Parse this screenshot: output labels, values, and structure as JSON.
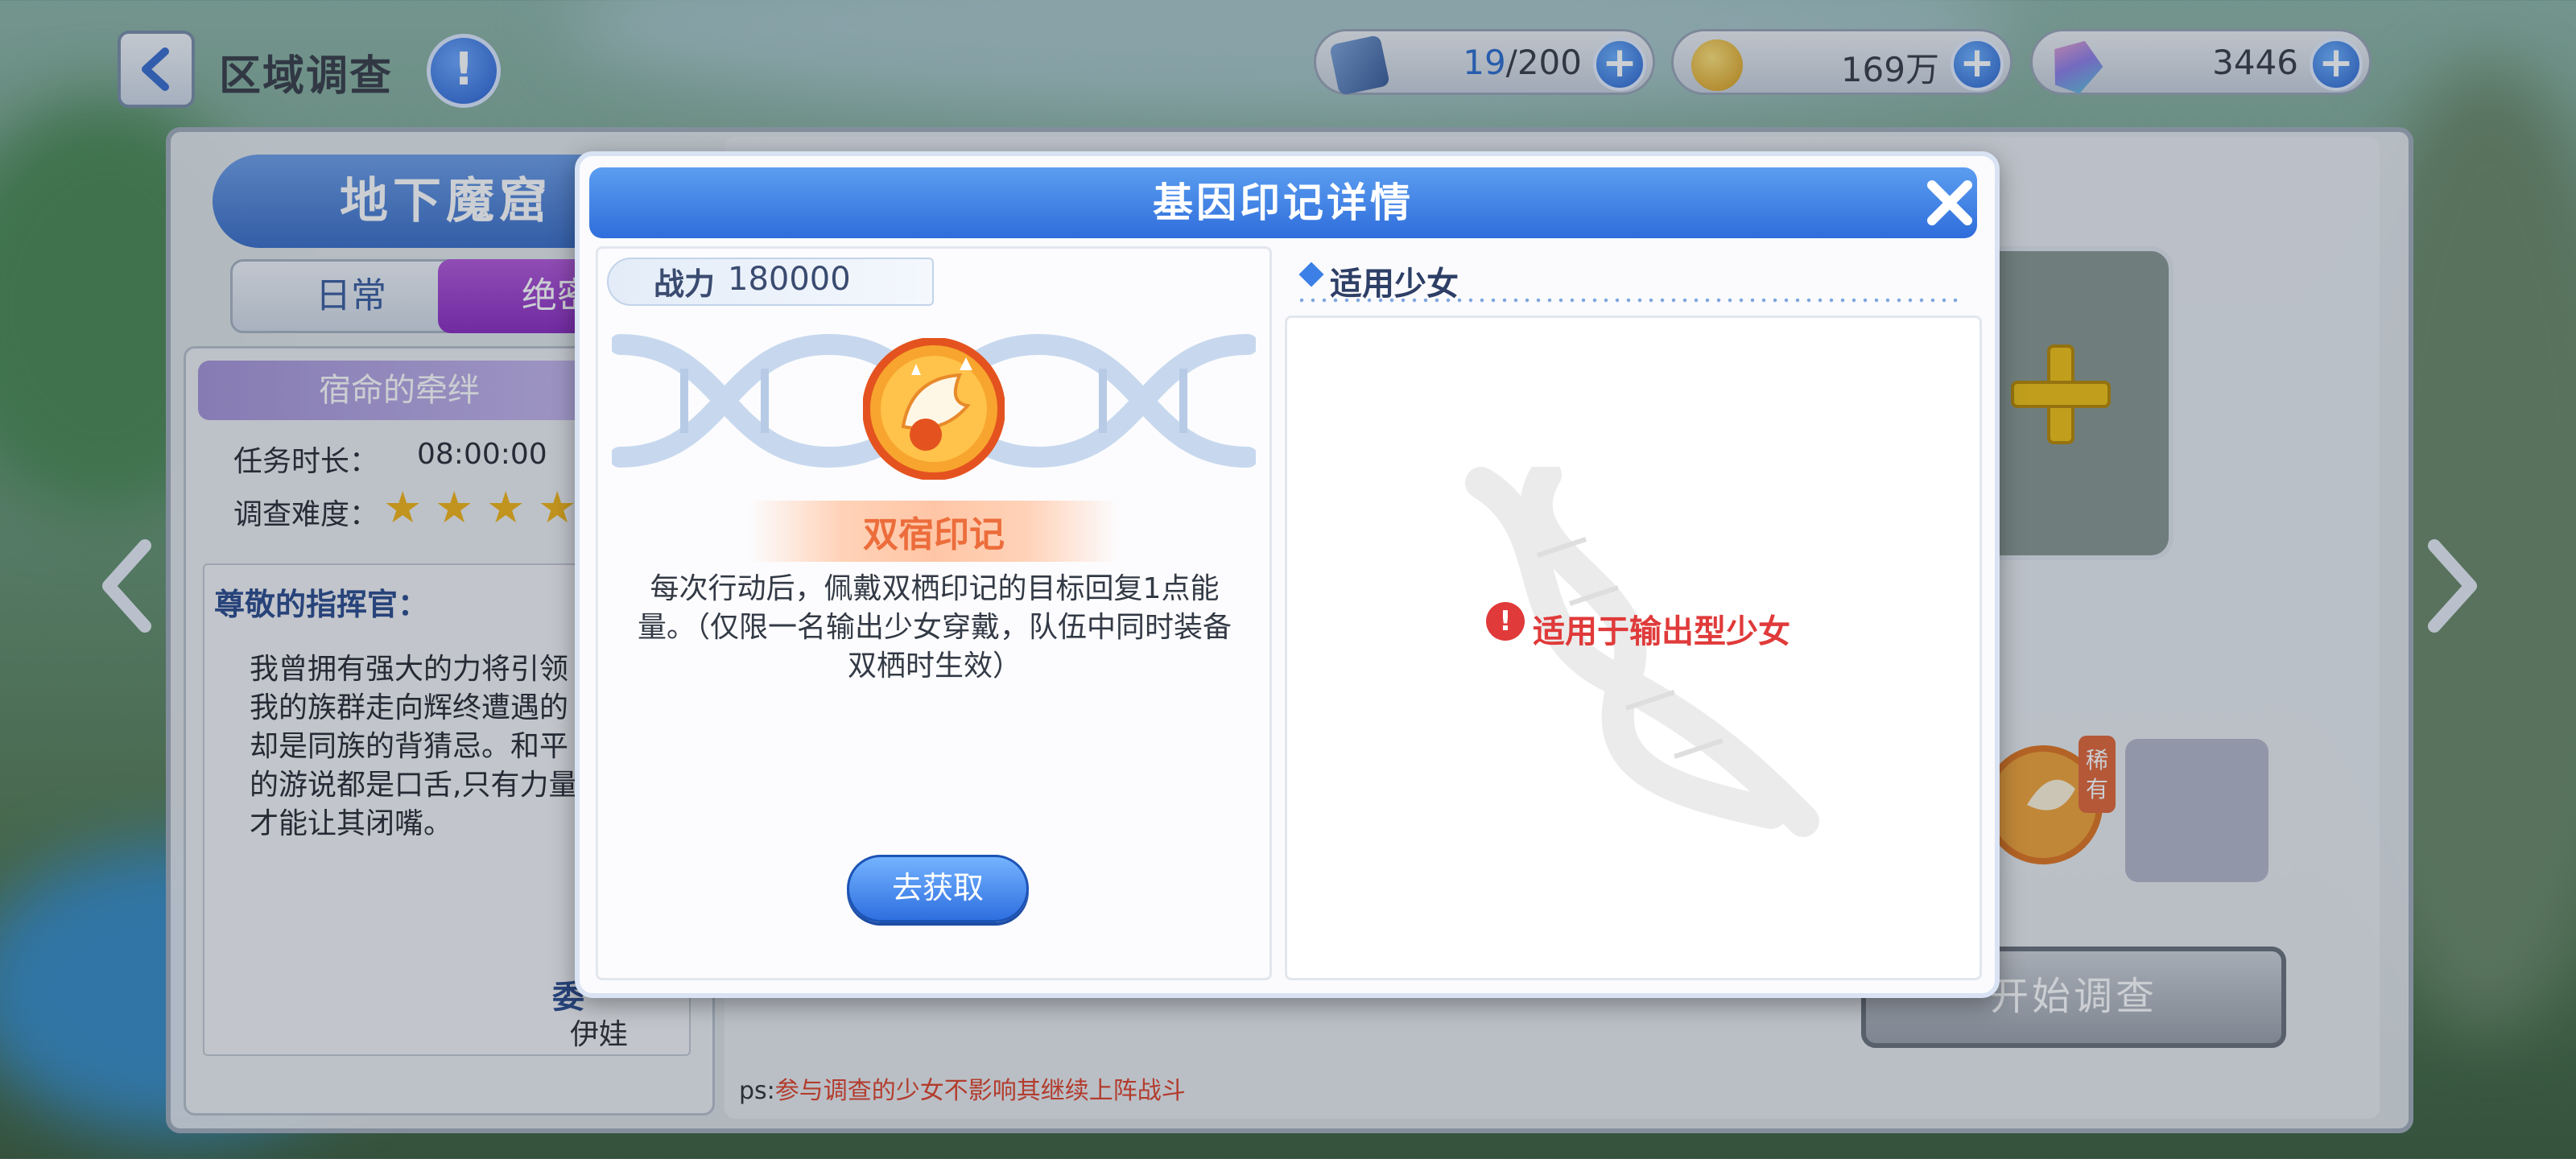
{
  "header": {
    "title": "区域调查",
    "info_icon": "!",
    "resources": [
      {
        "name": "stamina",
        "icon": "ticket-icon",
        "current": "19",
        "max": "/200"
      },
      {
        "name": "coins",
        "icon": "coin-icon",
        "value": "169万"
      },
      {
        "name": "gems",
        "icon": "crystal-icon",
        "value": "3446"
      }
    ],
    "plus_symbol": "+"
  },
  "background": {
    "zone_name": "地下魔窟",
    "tabs": [
      "日常",
      "绝密"
    ],
    "quest_title": "宿命的牵绊",
    "duration_label": "任务时长：",
    "duration_value": "08:00:00",
    "difficulty_label": "调查难度：",
    "difficulty_stars": 4,
    "letter_greeting": "尊敬的指挥官：",
    "letter_body": "我曾拥有强大的力将引领我的族群走向辉终遭遇的却是同族的背猜忌。和平的游说都是口舌,只有力量才能让其闭嘴。",
    "signer_label": "委",
    "signer_name": "伊娃",
    "start_button": "开始调查",
    "ps_prefix": "ps:",
    "ps_text": "参与调查的少女不影响其继续上阵战斗",
    "reward_tag": "稀有"
  },
  "dialog": {
    "title": "基因印记详情",
    "power_label": "战力",
    "power_value": "180000",
    "mark_name": "双宿印记",
    "mark_description": "每次行动后，佩戴双栖印记的目标回复1点能量。（仅限一名输出少女穿戴，队伍中同时装备双栖时生效）",
    "get_button": "去获取",
    "suitable_heading": "适用少女",
    "requirement": "适用于输出型少女"
  },
  "colors": {
    "accent_blue": "#2f6ddb",
    "mark_orange": "#ec6d3b",
    "warning_red": "#e03a3a",
    "purple_tab": "#8b2fc0"
  }
}
